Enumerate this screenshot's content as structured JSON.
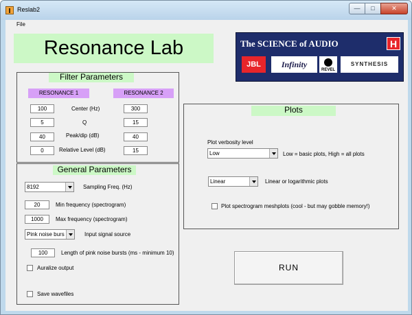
{
  "window": {
    "title": "Reslab2",
    "controls": {
      "minimize": "—",
      "maximize": "□",
      "close": "✕"
    }
  },
  "menu": {
    "file": "File"
  },
  "app_title": "Resonance Lab",
  "logo": {
    "text": "The SCIENCE of AUDIO",
    "brand_mark": "H",
    "brands": [
      "JBL",
      "Infinity",
      "REVEL",
      "SYNTHESIS"
    ]
  },
  "filter_parameters": {
    "title": "Filter Parameters",
    "resonance_1": "RESONANCE 1",
    "resonance_2": "RESONANCE 2",
    "rows": [
      {
        "label": "Center (Hz)",
        "r1": "100",
        "r2": "300"
      },
      {
        "label": "Q",
        "r1": "5",
        "r2": "15"
      },
      {
        "label": "Peak/dip (dB)",
        "r1": "40",
        "r2": "40"
      },
      {
        "label": "Relative Level (dB)",
        "r1": "0",
        "r2": "15"
      }
    ]
  },
  "general_parameters": {
    "title": "General Parameters",
    "sampling_freq": {
      "value": "8192",
      "label": "Sampling Freq. (Hz)"
    },
    "min_frequency": {
      "value": "20",
      "label": "Min frequency (spectrogram)"
    },
    "max_frequency": {
      "value": "1000",
      "label": "Max frequency (spectrogram)"
    },
    "input_source": {
      "value": "Pink noise burs",
      "label": "Input signal source"
    },
    "pink_length": {
      "value": "100",
      "label": "Length of pink noise bursts (ms - minimum 10)"
    },
    "auralize": {
      "label": "Auralize output",
      "checked": false
    },
    "save_wavefiles": {
      "label": "Save wavefiles",
      "checked": false
    }
  },
  "plots": {
    "title": "Plots",
    "verbosity_label": "Plot verbosity level",
    "verbosity_value": "Low",
    "verbosity_hint": "Low = basic plots,  High = all plots",
    "scale_value": "Linear",
    "scale_hint": "Linear or logarithmic plots",
    "meshplots": {
      "label": "Plot spectrogram meshplots (cool - but may gobble memory!)",
      "checked": false
    }
  },
  "run_button": "RUN",
  "colors": {
    "title_bg": "#ccf8c6",
    "resonance_bg": "#d7a0f7",
    "panel_bg": "#f0f0f0",
    "logo_bg": "#1e2d6b"
  }
}
